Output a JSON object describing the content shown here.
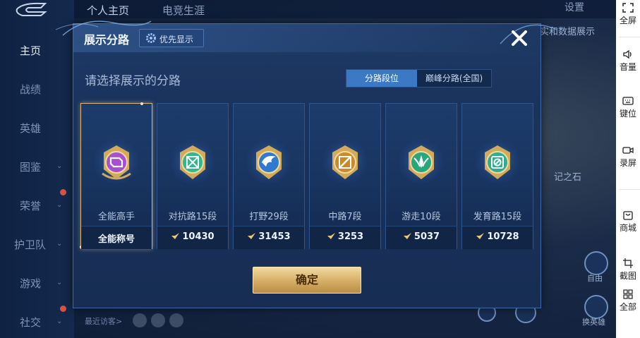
{
  "top_tabs": [
    "个人主页",
    "电竞生涯"
  ],
  "settings_label": "设置",
  "nav": {
    "items": [
      {
        "label": "主页",
        "active": true
      },
      {
        "label": "战绩"
      },
      {
        "label": "英雄"
      },
      {
        "label": "图鉴",
        "chevron": true
      },
      {
        "label": "荣誉",
        "chevron": true,
        "badge": true
      },
      {
        "label": "护卫队",
        "chevron": true
      },
      {
        "label": "游戏",
        "chevron": true
      },
      {
        "label": "社交",
        "chevron": true,
        "badge": true
      }
    ]
  },
  "background": {
    "hint_top": "实和数据展示",
    "hint_mid": "记之石",
    "btn_right_1": "自由",
    "btn_right_2": "换英雄",
    "visitors_label": "最近访客>"
  },
  "modal": {
    "title": "展示分路",
    "priority_button": "优先显示",
    "subtitle": "请选择展示的分路",
    "toggle": [
      "分路段位",
      "巅峰分路(全国)"
    ],
    "toggle_active": 0,
    "cards": [
      {
        "rank": "全能高手",
        "value": "全能称号",
        "selected": true,
        "emblem": "all-round-emblem-icon",
        "color": "#a74fd0"
      },
      {
        "rank": "对抗路15段",
        "value": "10430",
        "emblem": "clash-lane-emblem-icon",
        "color": "#2fb88d"
      },
      {
        "rank": "打野29段",
        "value": "31453",
        "emblem": "jungle-emblem-icon",
        "color": "#2f7ad0"
      },
      {
        "rank": "中路7段",
        "value": "3253",
        "emblem": "mid-lane-emblem-icon",
        "color": "#c98a2c"
      },
      {
        "rank": "游走10段",
        "value": "5037",
        "emblem": "roam-emblem-icon",
        "color": "#29a77c"
      },
      {
        "rank": "发育路15段",
        "value": "10728",
        "emblem": "farm-lane-emblem-icon",
        "color": "#2fae8f"
      }
    ],
    "confirm_button": "确定"
  },
  "right_toolbar": [
    {
      "label": "全屏",
      "icon": "fullscreen-icon"
    },
    {
      "label": "音量",
      "icon": "volume-icon"
    },
    {
      "label": "键位",
      "icon": "keyboard-icon"
    },
    {
      "label": "录屏",
      "icon": "record-icon"
    },
    {
      "label": "商城",
      "icon": "shop-icon"
    },
    {
      "label": "截图",
      "icon": "crop-icon"
    },
    {
      "label": "全部",
      "icon": "grid-icon"
    }
  ]
}
